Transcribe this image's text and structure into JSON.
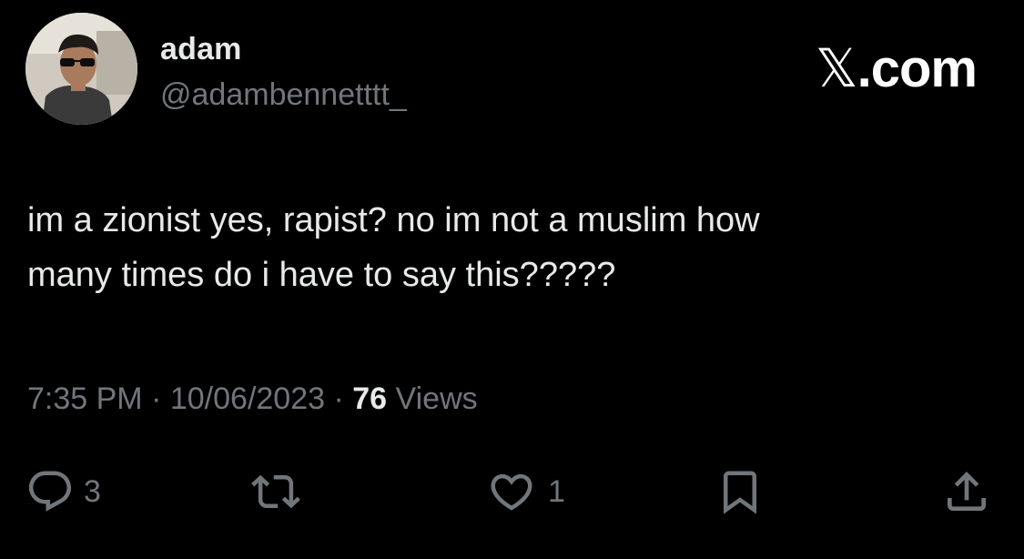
{
  "author": {
    "display_name": "adam",
    "handle": "@adambennetttt_"
  },
  "brand": {
    "x_glyph": "𝕏",
    "suffix": ".com"
  },
  "tweet": {
    "text": "im a zionist yes, rapist? no im not a muslim how\nmany times do i have to say this?????",
    "time": "7:35 PM",
    "separator": "·",
    "date": "10/06/2023",
    "views_count": "76",
    "views_label": "Views"
  },
  "actions": {
    "reply_count": "3",
    "like_count": "1",
    "icons": {
      "reply": "reply-icon",
      "retweet": "retweet-icon",
      "like": "heart-icon",
      "bookmark": "bookmark-icon",
      "share": "share-icon"
    }
  },
  "colors": {
    "background": "#000000",
    "primary_text": "#e7e9ea",
    "secondary_text": "#71767b"
  }
}
